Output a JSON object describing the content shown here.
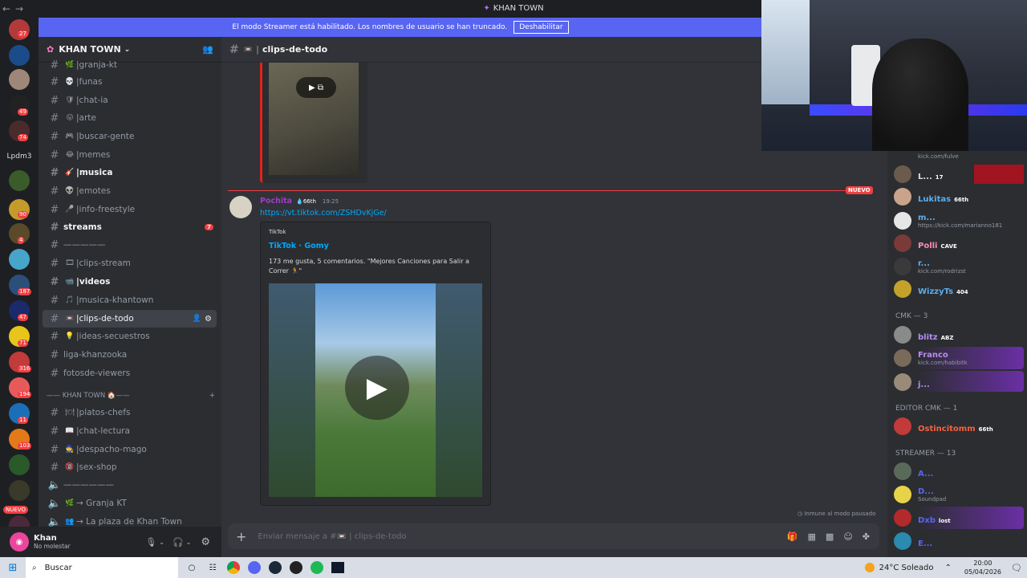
{
  "window": {
    "title": "KHAN TOWN",
    "nav_back": "←",
    "nav_fwd": "→"
  },
  "banner": {
    "text": "El modo Streamer está habilitado. Los nombres de usuario se han truncado.",
    "button": "Deshabilitar"
  },
  "rail": {
    "badges": [
      "27",
      "49",
      "74",
      "90",
      "4",
      "187",
      "47",
      "71",
      "316",
      "194",
      "11",
      "103"
    ],
    "text_server": "Lpdm3",
    "new_label": "NUEVO"
  },
  "sidebar": {
    "guild_name": "KHAN TOWN",
    "channels": [
      {
        "name": "granja-kt",
        "emoji": "🌿"
      },
      {
        "name": "funas",
        "emoji": "💀"
      },
      {
        "name": "chat-ia",
        "emoji": "🛡"
      },
      {
        "name": "arte",
        "emoji": "😛"
      },
      {
        "name": "buscar-gente",
        "emoji": "🎮"
      },
      {
        "name": "memes",
        "emoji": "😂"
      },
      {
        "name": "musica",
        "emoji": "🎸"
      },
      {
        "name": "emotes",
        "emoji": "👽"
      },
      {
        "name": "info-freestyle",
        "emoji": "🎤"
      },
      {
        "name": "streams",
        "emoji": ""
      },
      {
        "name": "—————",
        "emoji": ""
      },
      {
        "name": "clips-stream",
        "emoji": "🎞"
      },
      {
        "name": "videos",
        "emoji": "📹"
      },
      {
        "name": "musica-khantown",
        "emoji": "🎵"
      },
      {
        "name": "clips-de-todo",
        "emoji": "📼"
      },
      {
        "name": "ideas-secuestros",
        "emoji": "💡"
      },
      {
        "name": "liga-khanzooka",
        "emoji": ""
      },
      {
        "name": "fotosde-viewers",
        "emoji": ""
      },
      {
        "name": "platos-chefs",
        "emoji": "🍽"
      },
      {
        "name": "chat-lectura",
        "emoji": "📖"
      },
      {
        "name": "despacho-mago",
        "emoji": "🧙"
      },
      {
        "name": "sex-shop",
        "emoji": "🔞"
      },
      {
        "name": "——————",
        "emoji": ""
      },
      {
        "name": "→ Granja KT",
        "emoji": "🌿"
      },
      {
        "name": "→ La plaza de Khan Town",
        "emoji": "👥"
      }
    ],
    "streams_badge": "7",
    "category": "—— KHAN TOWN 🏠——"
  },
  "user": {
    "name": "Khan",
    "status": "No molestar"
  },
  "chat": {
    "channel": "clips-de-todo",
    "new_divider": "NUEVO",
    "message": {
      "author": "Pochita",
      "badge": "66th",
      "time": "19:25",
      "link": "https://vt.tiktok.com/ZSHDvKjGe/",
      "embed_provider": "TikTok",
      "embed_title": "TikTok · Gomy",
      "embed_desc": "173 me gusta, 5 comentarios. \"Mejores Canciones para Salir a Correr 🏃\""
    },
    "immune_note": "Inmune al modo pausado",
    "placeholder": "Enviar mensaje a #📼 | clips-de-todo"
  },
  "members": {
    "top_sub": "kick.com/fulve",
    "online": [
      {
        "name": "L...",
        "tag": "17",
        "sub": "",
        "color": "#dbdee1"
      },
      {
        "name": "Lukitas",
        "tag": "66th",
        "sub": "",
        "color": "#5dadec"
      },
      {
        "name": "m...",
        "tag": "",
        "sub": "https://kick.com/marianno181",
        "color": "#5dadec"
      },
      {
        "name": "Polli",
        "tag": "CAVE",
        "sub": "",
        "color": "#ff8ab7"
      },
      {
        "name": "r...",
        "tag": "",
        "sub": "kick.com/rodrizst",
        "color": "#5dadec"
      },
      {
        "name": "WizzyTs",
        "tag": "404",
        "sub": "",
        "color": "#5dadec"
      }
    ],
    "role_cmk": "CMK — 3",
    "cmk": [
      {
        "name": "blitz",
        "tag": "ABZ",
        "sub": "",
        "color": "#b68bf2"
      },
      {
        "name": "Franco",
        "tag": "",
        "sub": "kick.com/habibitk",
        "color": "#b68bf2"
      },
      {
        "name": "j...",
        "tag": "",
        "sub": "",
        "color": "#b68bf2"
      }
    ],
    "role_editor": "EDITOR CMK — 1",
    "editor": [
      {
        "name": "Ostincitomm",
        "tag": "66th",
        "sub": "",
        "color": "#f9603e"
      }
    ],
    "role_streamer": "STREAMER — 13",
    "streamer": [
      {
        "name": "A...",
        "tag": "",
        "sub": "",
        "color": "#5865f2"
      },
      {
        "name": "D...",
        "tag": "",
        "sub": "Soundpad",
        "color": "#5865f2"
      },
      {
        "name": "Dxb",
        "tag": "lost",
        "sub": "",
        "color": "#5865f2"
      },
      {
        "name": "E...",
        "tag": "",
        "sub": "",
        "color": "#5865f2"
      }
    ]
  },
  "taskbar": {
    "search": "Buscar",
    "weather": "24°C  Soleado",
    "time": "20:00",
    "date": "05/04/2026"
  }
}
